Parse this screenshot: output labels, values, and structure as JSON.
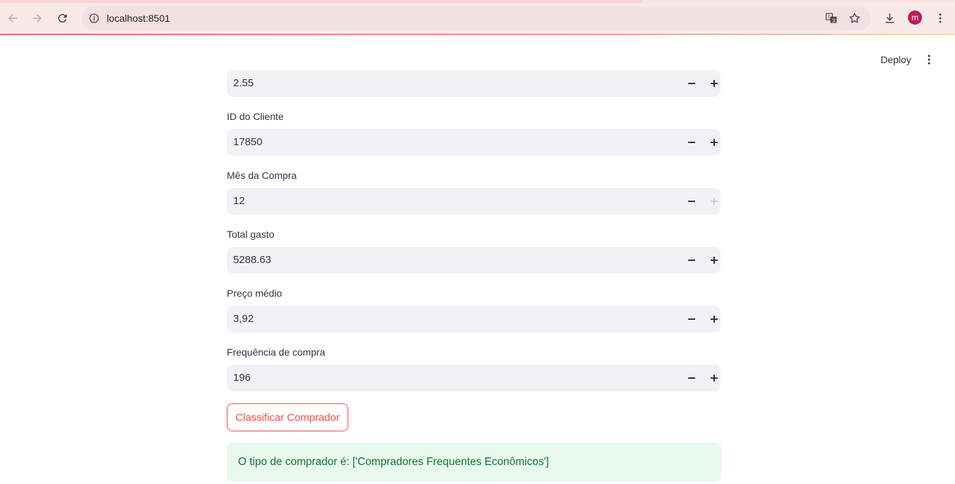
{
  "browser": {
    "url": "localhost:8501",
    "profile_initial": "m",
    "icons": [
      "back-arrow-icon",
      "forward-arrow-icon",
      "reload-icon",
      "site-info-icon",
      "translate-icon",
      "star-icon",
      "download-icon",
      "kebab-menu-icon"
    ]
  },
  "app": {
    "deploy_label": "Deploy",
    "fields": [
      {
        "label": "",
        "value": "2.55"
      },
      {
        "label": "ID do Cliente",
        "value": "17850"
      },
      {
        "label": "Mês da Compra",
        "value": "12"
      },
      {
        "label": "Total gasto",
        "value": "5288.63"
      },
      {
        "label": "Preço médio",
        "value": "3,92"
      },
      {
        "label": "Frequência de compra",
        "value": "196"
      }
    ],
    "classify_button_label": "Classificar Comprador",
    "result_text": "O tipo de comprador é: ['Compradores Frequentes Econômicos']",
    "colors": {
      "accent": "#ff4b4b",
      "input_bg": "#f0f2f6",
      "success_bg": "#e8f9ee",
      "success_text": "#177233"
    }
  }
}
